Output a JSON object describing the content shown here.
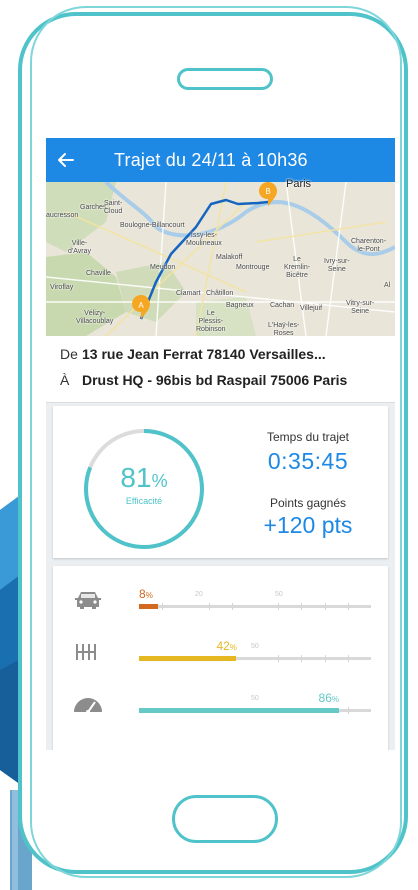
{
  "appbar": {
    "title": "Trajet du 24/11 à 10h36"
  },
  "map": {
    "labels": [
      "Paris",
      "Garches",
      "Saint-\nCloud",
      "Boulogne-Billancourt",
      "Ville-\nd'Avray",
      "Issy-les-\nMoulineaux",
      "Malakoff",
      "Montrouge",
      "Chaville",
      "Meudon",
      "Le\nKremlin-\nBicêtre",
      "Ivry-sur-\nSeine",
      "Charenton-\nle-Pont",
      "Viroflay",
      "Clamart",
      "Châtillon",
      "Bagneux",
      "Cachan",
      "Villejuif",
      "Vitry-sur-\nSeine",
      "Vélizy-\nVillacoublay",
      "Le\nPlessis-\nRobinson",
      "L'Haÿ-les-\nRoses",
      "aucresson",
      "Al"
    ],
    "marker_start": "A",
    "marker_end": "B"
  },
  "addresses": {
    "from_prefix": "De",
    "from": "13 rue Jean Ferrat 78140 Versailles...",
    "to_prefix": "À",
    "to": "Drust HQ - 96bis bd Raspail 75006 Paris"
  },
  "stats": {
    "efficiency_value": "81",
    "efficiency_unit": "%",
    "efficiency_fraction": 0.81,
    "efficiency_label": "Efficacité",
    "time_label": "Temps du trajet",
    "time_value": "0:35:45",
    "points_label": "Points gagnés",
    "points_value": "+120 pts"
  },
  "scores": [
    {
      "icon": "car-front-icon",
      "value": 8,
      "value_label": "8",
      "unit": "%",
      "color": "#d2691e",
      "ticks": [
        "20",
        "50"
      ]
    },
    {
      "icon": "gear-shift-icon",
      "value": 42,
      "value_label": "42",
      "unit": "%",
      "color": "#e5b822",
      "ticks": [
        "50"
      ]
    },
    {
      "icon": "speedometer-icon",
      "value": 86,
      "value_label": "86",
      "unit": "%",
      "color": "#64c9c7",
      "ticks": [
        "50"
      ]
    }
  ],
  "colors": {
    "primary": "#1e88e5",
    "accent": "#4fc3c9",
    "route": "#1565c0",
    "marker": "#f5a623"
  }
}
